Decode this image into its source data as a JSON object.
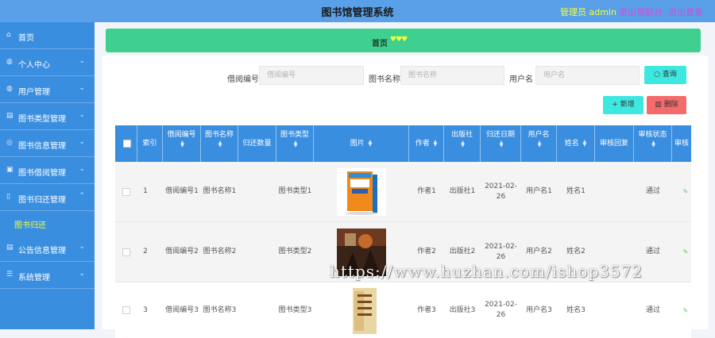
{
  "header": {
    "title": "图书馆管理系统",
    "admin": "管理员 admin",
    "back_link": "退出到前台",
    "logout_link": "退出登录"
  },
  "sidebar": {
    "items": [
      {
        "label": "首页",
        "icon": "home-icon"
      },
      {
        "label": "个人中心",
        "icon": "user-icon"
      },
      {
        "label": "用户管理",
        "icon": "users-icon"
      },
      {
        "label": "图书类型管理",
        "icon": "list-icon"
      },
      {
        "label": "图书信息管理",
        "icon": "book-icon"
      },
      {
        "label": "图书借阅管理",
        "icon": "borrow-icon"
      },
      {
        "label": "图书归还管理",
        "icon": "return-icon"
      },
      {
        "label": "公告信息管理",
        "icon": "notice-icon"
      },
      {
        "label": "系统管理",
        "icon": "settings-icon"
      }
    ],
    "submenu": {
      "label": "图书归还"
    }
  },
  "breadcrumb": {
    "home": "首页",
    "hearts": "♥♥♥"
  },
  "search": {
    "borrow_no_label": "借阅编号",
    "borrow_no_placeholder": "借阅编号",
    "book_name_label": "图书名称",
    "book_name_placeholder": "图书名称",
    "username_label": "用户名",
    "username_placeholder": "用户名",
    "query_button": "查询"
  },
  "actions": {
    "add_button": "新增",
    "delete_button": "删除"
  },
  "table": {
    "columns": [
      "索引",
      "借阅编号",
      "图书名称",
      "归还数量",
      "图书类型",
      "图片",
      "作者",
      "出版社",
      "归还日期",
      "用户名",
      "姓名",
      "审核回复",
      "审核状态",
      "审核"
    ],
    "rows": [
      {
        "index": "1",
        "borrow_no": "借阅编号1",
        "book_name": "图书名称1",
        "return_qty": "",
        "book_type": "图书类型1",
        "author": "作者1",
        "publisher": "出版社1",
        "return_date": "2021-02-26",
        "username": "用户名1",
        "name": "姓名1",
        "review_reply": "",
        "review_status": "通过"
      },
      {
        "index": "2",
        "borrow_no": "借阅编号2",
        "book_name": "图书名称2",
        "return_qty": "",
        "book_type": "图书类型2",
        "author": "作者2",
        "publisher": "出版社2",
        "return_date": "2021-02-26",
        "username": "用户名2",
        "name": "姓名2",
        "review_reply": "",
        "review_status": "通过"
      },
      {
        "index": "3",
        "borrow_no": "借阅编号3",
        "book_name": "图书名称3",
        "return_qty": "",
        "book_type": "图书类型3",
        "author": "作者3",
        "publisher": "出版社3",
        "return_date": "2021-02-26",
        "username": "用户名3",
        "name": "姓名3",
        "review_reply": "",
        "review_status": "通过"
      }
    ]
  },
  "watermark": "https://www.huzhan.com/ishop3572",
  "colors": {
    "topbar": "#5aa0e8",
    "sidebar": "#3a8ee0",
    "breadcrumb": "#3fd08f",
    "query_button": "#3ce8df",
    "delete_button": "#f46b6b",
    "admin_text": "#f1ff3a",
    "link_text": "#d54ad8"
  }
}
